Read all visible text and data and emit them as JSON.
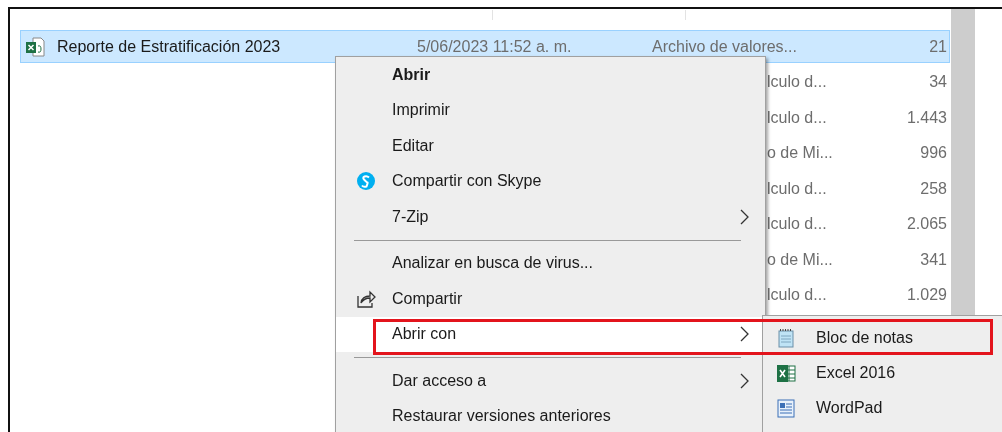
{
  "files": [
    {
      "name": "Reporte de Estratificación 2023",
      "date": "5/06/2023 11:52 a. m.",
      "type": "Archivo de valores...",
      "size": "21",
      "selected": true
    },
    {
      "type": "lculo d...",
      "size": "34",
      "selected": false
    },
    {
      "type": "lculo d...",
      "size": "1.443",
      "selected": false
    },
    {
      "type": "o de Mi...",
      "size": "996",
      "selected": false
    },
    {
      "type": "lculo d...",
      "size": "258",
      "selected": false
    },
    {
      "type": "lculo d...",
      "size": "2.065",
      "selected": false
    },
    {
      "type": "o de Mi...",
      "size": "341",
      "selected": false
    },
    {
      "type": "lculo d...",
      "size": "1.029",
      "selected": false
    }
  ],
  "context_menu": [
    {
      "kind": "item",
      "label": "Abrir",
      "default": true,
      "submenu": false,
      "selected": false
    },
    {
      "kind": "item",
      "label": "Imprimir",
      "default": false,
      "submenu": false,
      "selected": false
    },
    {
      "kind": "item",
      "label": "Editar",
      "default": false,
      "submenu": false,
      "selected": false
    },
    {
      "kind": "skype",
      "label": "Compartir con Skype",
      "default": false,
      "submenu": false,
      "selected": false
    },
    {
      "kind": "item",
      "label": "7-Zip",
      "default": false,
      "submenu": true,
      "selected": false
    },
    {
      "kind": "separator"
    },
    {
      "kind": "item",
      "label": "Analizar en busca de virus...",
      "default": false,
      "submenu": false,
      "selected": false
    },
    {
      "kind": "share",
      "label": "Compartir",
      "default": false,
      "submenu": false,
      "selected": false
    },
    {
      "kind": "item",
      "label": "Abrir con",
      "default": false,
      "submenu": true,
      "selected": true
    },
    {
      "kind": "separator"
    },
    {
      "kind": "item",
      "label": "Dar acceso a",
      "default": false,
      "submenu": true,
      "selected": false
    },
    {
      "kind": "item",
      "label": "Restaurar versiones anteriores",
      "default": false,
      "submenu": false,
      "selected": false
    }
  ],
  "submenu": [
    {
      "label": "Bloc de notas",
      "selected": false
    },
    {
      "label": "Excel 2016",
      "selected": false
    },
    {
      "label": "WordPad",
      "selected": false
    }
  ]
}
